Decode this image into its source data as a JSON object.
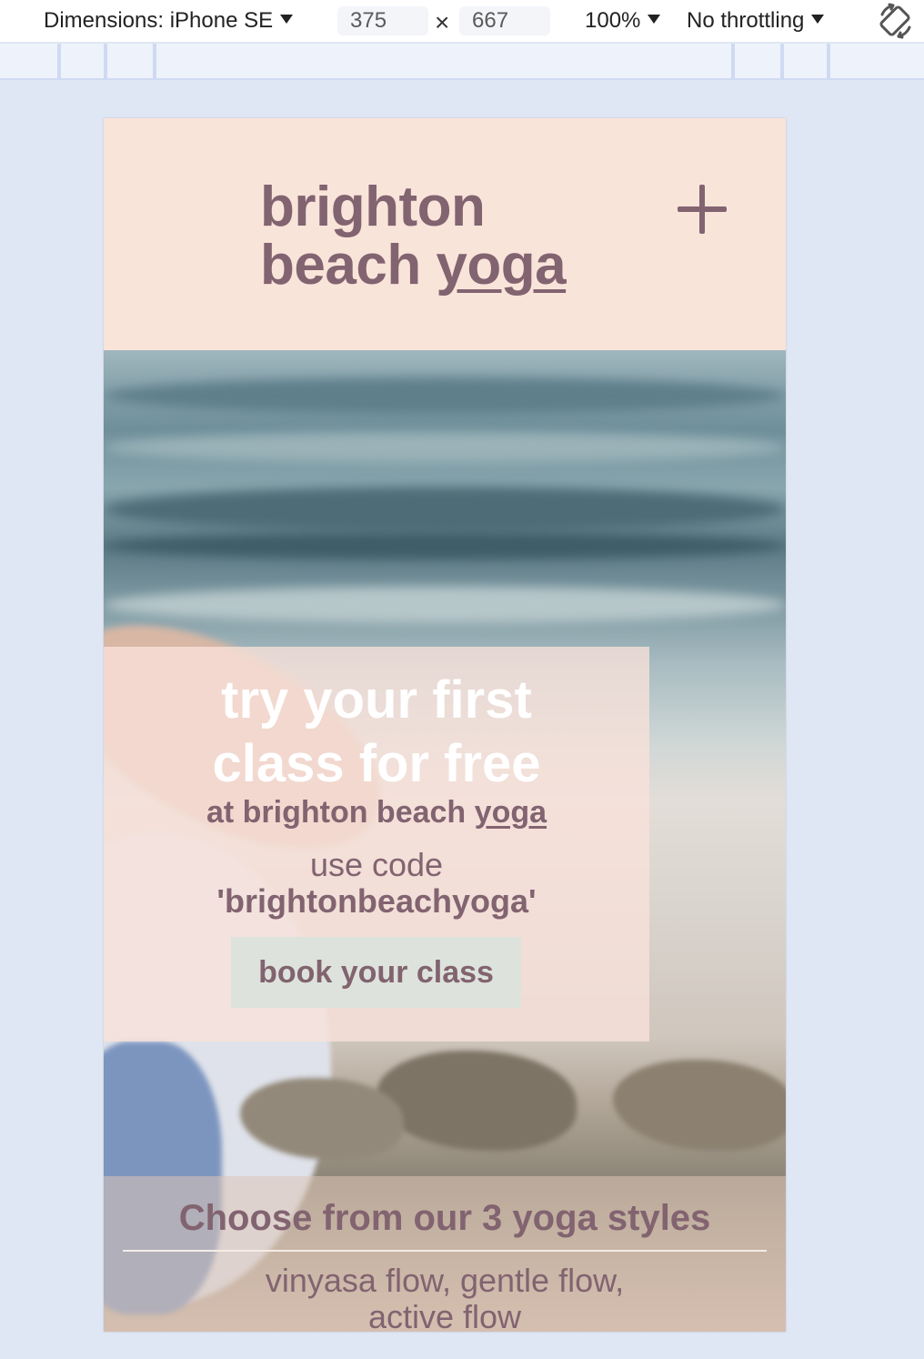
{
  "devtools": {
    "dimensions_label": "Dimensions: iPhone SE",
    "width_value": "375",
    "times_sign": "×",
    "height_value": "667",
    "zoom_label": "100%",
    "throttling_label": "No throttling",
    "rotate_icon": "rotate-device-icon"
  },
  "site": {
    "logo_line1": "brighton",
    "logo_line2_prefix": "beach ",
    "logo_line2_link": "yoga",
    "menu_icon": "plus-icon",
    "promo": {
      "title_line1": "try your first",
      "title_line2": "class for free",
      "subtitle_prefix": "at brighton beach ",
      "subtitle_link": "yoga",
      "code_label": "use code",
      "code_value": "'brightonbeachyoga'",
      "button_label": "book your class"
    },
    "styles": {
      "heading": "Choose from our 3 yoga styles",
      "list_line1": "vinyasa flow, gentle flow,",
      "list_line2": "active flow"
    }
  },
  "colors": {
    "brand_text": "#826370",
    "header_bg": "#f9e4da",
    "button_bg": "#dde3dc",
    "page_bg": "#dfe6f4"
  }
}
